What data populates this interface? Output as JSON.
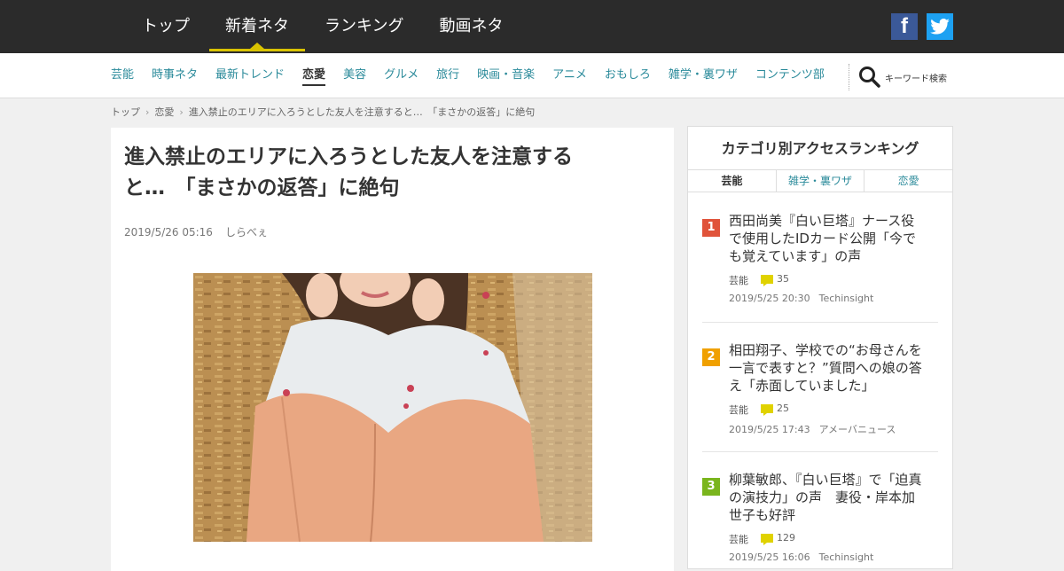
{
  "topnav": {
    "items": [
      "トップ",
      "新着ネタ",
      "ランキング",
      "動画ネタ"
    ],
    "active_index": 1
  },
  "social": {
    "facebook_glyph": "f",
    "twitter_icon": "twitter-bird"
  },
  "categories": {
    "items": [
      "芸能",
      "時事ネタ",
      "最新トレンド",
      "恋愛",
      "美容",
      "グルメ",
      "旅行",
      "映画・音楽",
      "アニメ",
      "おもしろ",
      "雑学・裏ワザ",
      "コンテンツ部"
    ],
    "active_index": 3
  },
  "search": {
    "label": "キーワード検索",
    "icon": "search-icon"
  },
  "breadcrumb": [
    "トップ",
    "恋愛",
    "進入禁止のエリアに入ろうとした友人を注意すると…　「まさかの返答」に絶句"
  ],
  "article": {
    "title_line1": "進入禁止のエリアに入ろうとした友人を注意する",
    "title_line2": "と…　「まさかの返答」に絶句",
    "date": "2019/5/26 05:16",
    "source": "しらべぇ"
  },
  "ranking": {
    "heading": "カテゴリ別アクセスランキング",
    "tabs": [
      "芸能",
      "雑学・裏ワザ",
      "恋愛"
    ],
    "items": [
      {
        "rank": "1",
        "color": "#e0533a",
        "title": "西田尚美『白い巨塔』ナース役で使用したIDカード公開「今でも覚えています」の声",
        "category": "芸能",
        "comments": "35",
        "date": "2019/5/25 20:30",
        "source": "Techinsight"
      },
      {
        "rank": "2",
        "color": "#f0a000",
        "title": "相田翔子、学校での“お母さんを一言で表すと？”質問への娘の答え「赤面していました」",
        "category": "芸能",
        "comments": "25",
        "date": "2019/5/25 17:43",
        "source": "アメーバニュース"
      },
      {
        "rank": "3",
        "color": "#7ab51d",
        "title": "柳葉敏郎、『白い巨塔』で「迫真の演技力」の声　妻役・岸本加世子も好評",
        "category": "芸能",
        "comments": "129",
        "date": "2019/5/25 16:06",
        "source": "Techinsight"
      }
    ]
  },
  "colors": {
    "topbar": "#2b2b2b",
    "accent": "#d9c300",
    "link": "#2a8a9a"
  }
}
